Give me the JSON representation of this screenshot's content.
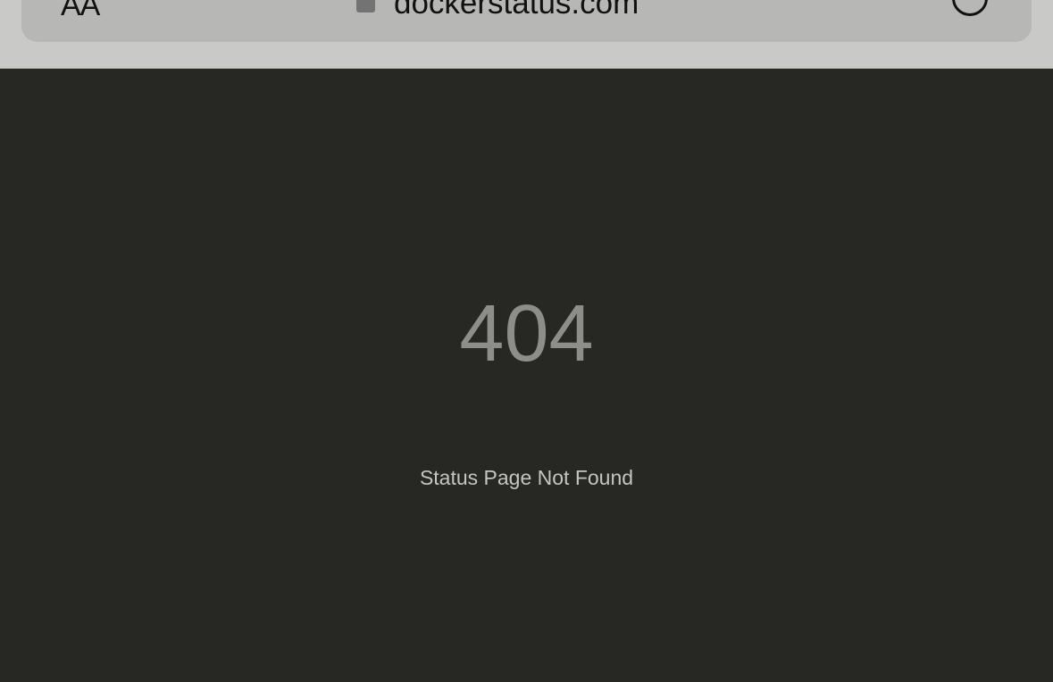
{
  "browser": {
    "reader_label": "AA",
    "lock_icon": "lock-icon",
    "url": "dockerstatus.com",
    "reload_icon": "reload-icon"
  },
  "page": {
    "error_code": "404",
    "message": "Status Page Not Found"
  },
  "colors": {
    "page_background": "#272824",
    "chrome_background": "#c9c9c7",
    "address_bar": "#b7b7b5",
    "error_code_text": "#8d8d8a",
    "message_text": "#c4c4c1"
  }
}
